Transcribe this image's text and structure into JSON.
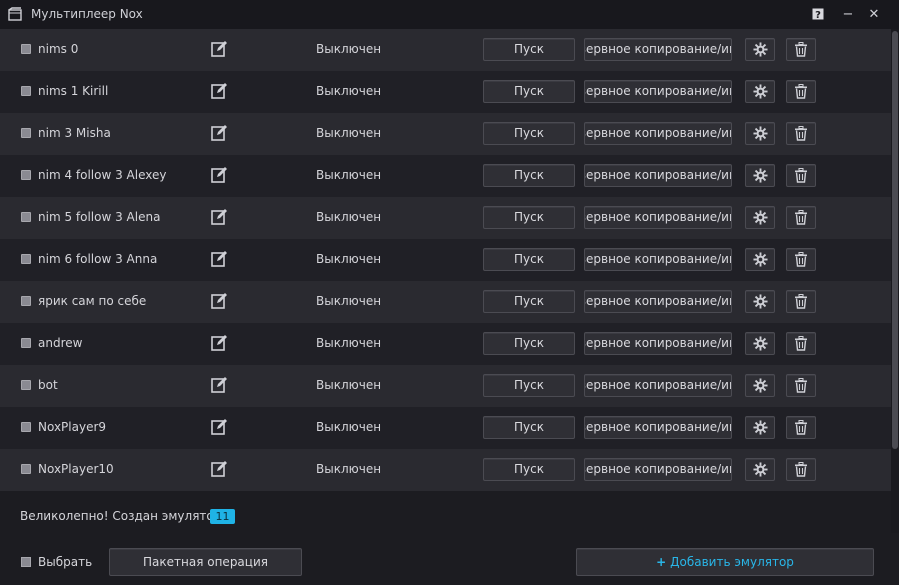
{
  "window": {
    "title": "Мультиплеер Nox",
    "help_label": "?",
    "minimize_label": "−",
    "close_label": "✕"
  },
  "row_labels": {
    "status": "Выключен",
    "start": "Пуск",
    "backup": "Резервное копирование/импорт"
  },
  "emulators": [
    {
      "name": "nims 0",
      "status": "Выключен",
      "start": "Пуск",
      "backup": "Резервное копирование/импорт"
    },
    {
      "name": "nims 1 Kirill",
      "status": "Выключен",
      "start": "Пуск",
      "backup": "Резервное копирование/импорт"
    },
    {
      "name": "nim 3 Misha",
      "status": "Выключен",
      "start": "Пуск",
      "backup": "Резервное копирование/импорт"
    },
    {
      "name": "nim 4 follow 3 Alexey",
      "status": "Выключен",
      "start": "Пуск",
      "backup": "Резервное копирование/импорт"
    },
    {
      "name": "nim 5 follow 3 Alena",
      "status": "Выключен",
      "start": "Пуск",
      "backup": "Резервное копирование/импорт"
    },
    {
      "name": "nim 6 follow 3 Anna",
      "status": "Выключен",
      "start": "Пуск",
      "backup": "Резервное копирование/импорт"
    },
    {
      "name": "ярик сам по себе",
      "status": "Выключен",
      "start": "Пуск",
      "backup": "Резервное копирование/импорт"
    },
    {
      "name": "andrew",
      "status": "Выключен",
      "start": "Пуск",
      "backup": "Резервное копирование/импорт"
    },
    {
      "name": "bot",
      "status": "Выключен",
      "start": "Пуск",
      "backup": "Резервное копирование/импорт"
    },
    {
      "name": "NoxPlayer9",
      "status": "Выключен",
      "start": "Пуск",
      "backup": "Резервное копирование/импорт"
    },
    {
      "name": "NoxPlayer10",
      "status": "Выключен",
      "start": "Пуск",
      "backup": "Резервное копирование/импорт"
    }
  ],
  "notice": {
    "text": "Великолепно! Создан эмулятор:",
    "count": "11"
  },
  "footer": {
    "select_all_label": "Выбрать",
    "batch_label": "Пакетная операция",
    "add_label": "Добавить эмулятор"
  },
  "colors": {
    "accent": "#29b6e8",
    "badge": "#1fb3e6",
    "row_even": "#2a2a30",
    "row_odd": "#202026"
  }
}
